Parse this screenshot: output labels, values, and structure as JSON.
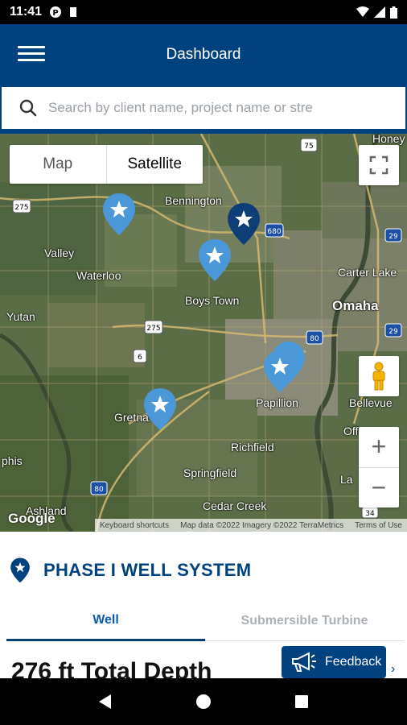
{
  "status_bar": {
    "time": "11:41"
  },
  "app_bar": {
    "title": "Dashboard"
  },
  "search": {
    "placeholder": "Search by client name, project name or stre"
  },
  "map": {
    "type_options": {
      "map": "Map",
      "satellite": "Satellite"
    },
    "selected_type": "Satellite",
    "labels": {
      "bennington": "Bennington",
      "valley": "Valley",
      "waterloo": "Waterloo",
      "boys_town": "Boys Town",
      "omaha": "Omaha",
      "carter_lake": "Carter Lake",
      "yutan": "Yutan",
      "honey": "Honey",
      "papillion": "Papillion",
      "bellevue": "Bellevue",
      "gretna": "Gretna",
      "richfield": "Richfield",
      "springfield": "Springfield",
      "cedar_creek": "Cedar Creek",
      "ashland": "Ashland",
      "ophis": "phis",
      "offutt": "Off",
      "la": "La"
    },
    "highways": {
      "h75": "75",
      "h275_top": "275",
      "h680": "680",
      "h29_top": "29",
      "h275_mid": "275",
      "h6": "6",
      "h80_mid": "80",
      "h29_bot": "29",
      "h80_bot": "80",
      "h34": "34"
    },
    "attribution": {
      "shortcuts": "Keyboard shortcuts",
      "data": "Map data ©2022 Imagery ©2022 TerraMetrics",
      "terms": "Terms of Use"
    },
    "logo": "Google",
    "zoom_in": "+",
    "zoom_out": "−"
  },
  "panel": {
    "title": "PHASE I WELL SYSTEM",
    "tabs": [
      "Well",
      "Submersible Turbine"
    ],
    "active_tab": "Well",
    "depth_text": "276 ft Total Depth"
  },
  "feedback": {
    "label": "Feedback"
  },
  "colors": {
    "primary": "#00427f",
    "pin_light": "#4a98d8",
    "pin_dark": "#0d3e78"
  }
}
